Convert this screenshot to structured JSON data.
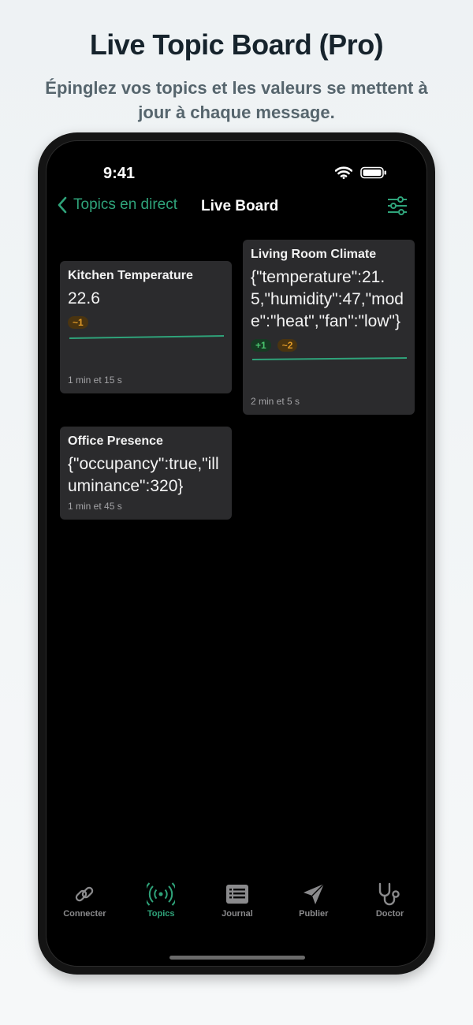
{
  "header": {
    "title": "Live Topic Board (Pro)",
    "subtitle": "Épinglez vos topics et les valeurs se mettent à jour à chaque message."
  },
  "status_bar": {
    "time": "9:41"
  },
  "nav": {
    "back_label": "Topics en direct",
    "title": "Live Board"
  },
  "cards": [
    {
      "title": "Kitchen Temperature",
      "value": "22.6",
      "badges": [
        {
          "text": "~1",
          "kind": "orange"
        }
      ],
      "age": "1 min et 15 s"
    },
    {
      "title": "Living Room Climate",
      "value": "{\"temperature\":21.5,\"humidity\":47,\"mode\":\"heat\",\"fan\":\"low\"}",
      "badges": [
        {
          "text": "+1",
          "kind": "green"
        },
        {
          "text": "~2",
          "kind": "orange"
        }
      ],
      "age": "2 min et 5 s"
    },
    {
      "title": "Office Presence",
      "value": "{\"occupancy\":true,\"illuminance\":320}",
      "badges": [],
      "age": "1 min et 45 s"
    }
  ],
  "tabbar": {
    "items": [
      {
        "label": "Connecter",
        "icon": "link-icon"
      },
      {
        "label": "Topics",
        "icon": "broadcast-icon",
        "active": true
      },
      {
        "label": "Journal",
        "icon": "journal-icon"
      },
      {
        "label": "Publier",
        "icon": "paper-plane-icon"
      },
      {
        "label": "Doctor",
        "icon": "stethoscope-icon"
      }
    ]
  },
  "colors": {
    "accent": "#2fa37a",
    "card_background": "#2b2b2d",
    "badge_orange": "#e09a28",
    "badge_green": "#49c46e"
  }
}
